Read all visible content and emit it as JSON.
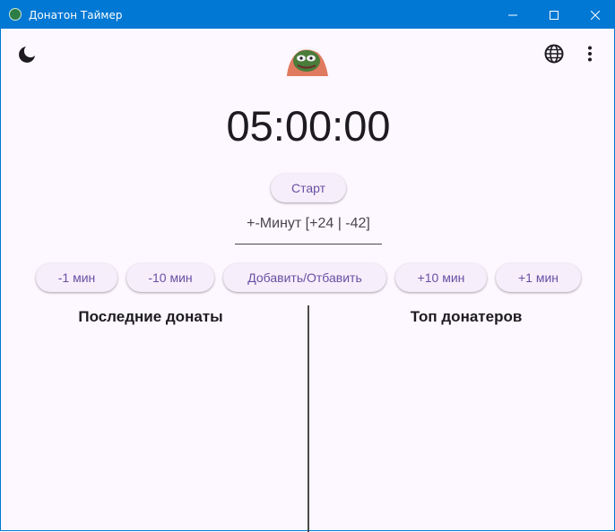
{
  "window": {
    "title": "Донатон Таймер"
  },
  "toolbar": {
    "theme_icon": "moon-icon",
    "language_icon": "globe-icon",
    "menu_icon": "more-vert-icon",
    "avatar_icon": "pepe-avatar"
  },
  "timer": {
    "display": "05:00:00"
  },
  "controls": {
    "start_label": "Старт",
    "minutes_label": "+-Минут [+24 | -42]",
    "minus1_label": "-1 мин",
    "minus10_label": "-10 мин",
    "add_label": "Добавить/Отбавить",
    "plus10_label": "+10 мин",
    "plus1_label": "+1 мин"
  },
  "panels": {
    "recent_title": "Последние донаты",
    "top_title": "Топ донатеров"
  },
  "colors": {
    "titlebar": "#0078d4",
    "background": "#fdf7ff",
    "button_text": "#6750a4"
  }
}
